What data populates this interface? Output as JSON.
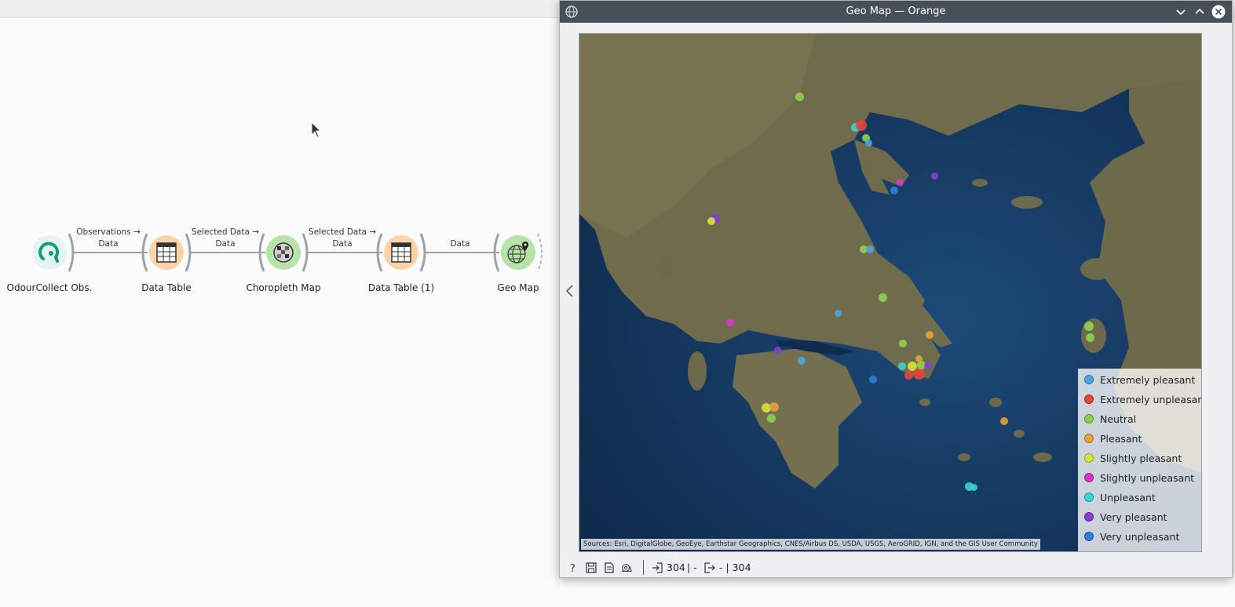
{
  "workflow": {
    "nodes": [
      {
        "label": "OdourCollect Obs."
      },
      {
        "label": "Data Table"
      },
      {
        "label": "Choropleth Map"
      },
      {
        "label": "Data Table (1)"
      },
      {
        "label": "Geo Map"
      }
    ],
    "links": [
      {
        "line1": "Observations →",
        "line2": "Data"
      },
      {
        "line1": "Selected Data →",
        "line2": "Data"
      },
      {
        "line1": "Selected Data →",
        "line2": "Data"
      },
      {
        "line1": "",
        "line2": "Data"
      }
    ]
  },
  "window": {
    "title": "Geo Map — Orange",
    "attribution": "Sources: Esri, DigitalGlobe, GeoEye, Earthstar Geographics, CNES/Airbus DS, USDA, USGS, AeroGRID, IGN, and the GIS User Community",
    "legend": [
      {
        "label": "Extremely pleasant",
        "color": "#4fa3e0"
      },
      {
        "label": "Extremely unpleasant",
        "color": "#e5453c"
      },
      {
        "label": "Neutral",
        "color": "#8fd14f"
      },
      {
        "label": "Pleasant",
        "color": "#e6a23c"
      },
      {
        "label": "Slightly pleasant",
        "color": "#d6e43a"
      },
      {
        "label": "Slightly unpleasant",
        "color": "#d938c6"
      },
      {
        "label": "Unpleasant",
        "color": "#37d5d0"
      },
      {
        "label": "Very pleasant",
        "color": "#8a3cd9"
      },
      {
        "label": "Very unpleasant",
        "color": "#2f7fd6"
      }
    ],
    "status": {
      "input_count": "304",
      "input_sep": "| -",
      "output_count": "- | 304"
    }
  }
}
